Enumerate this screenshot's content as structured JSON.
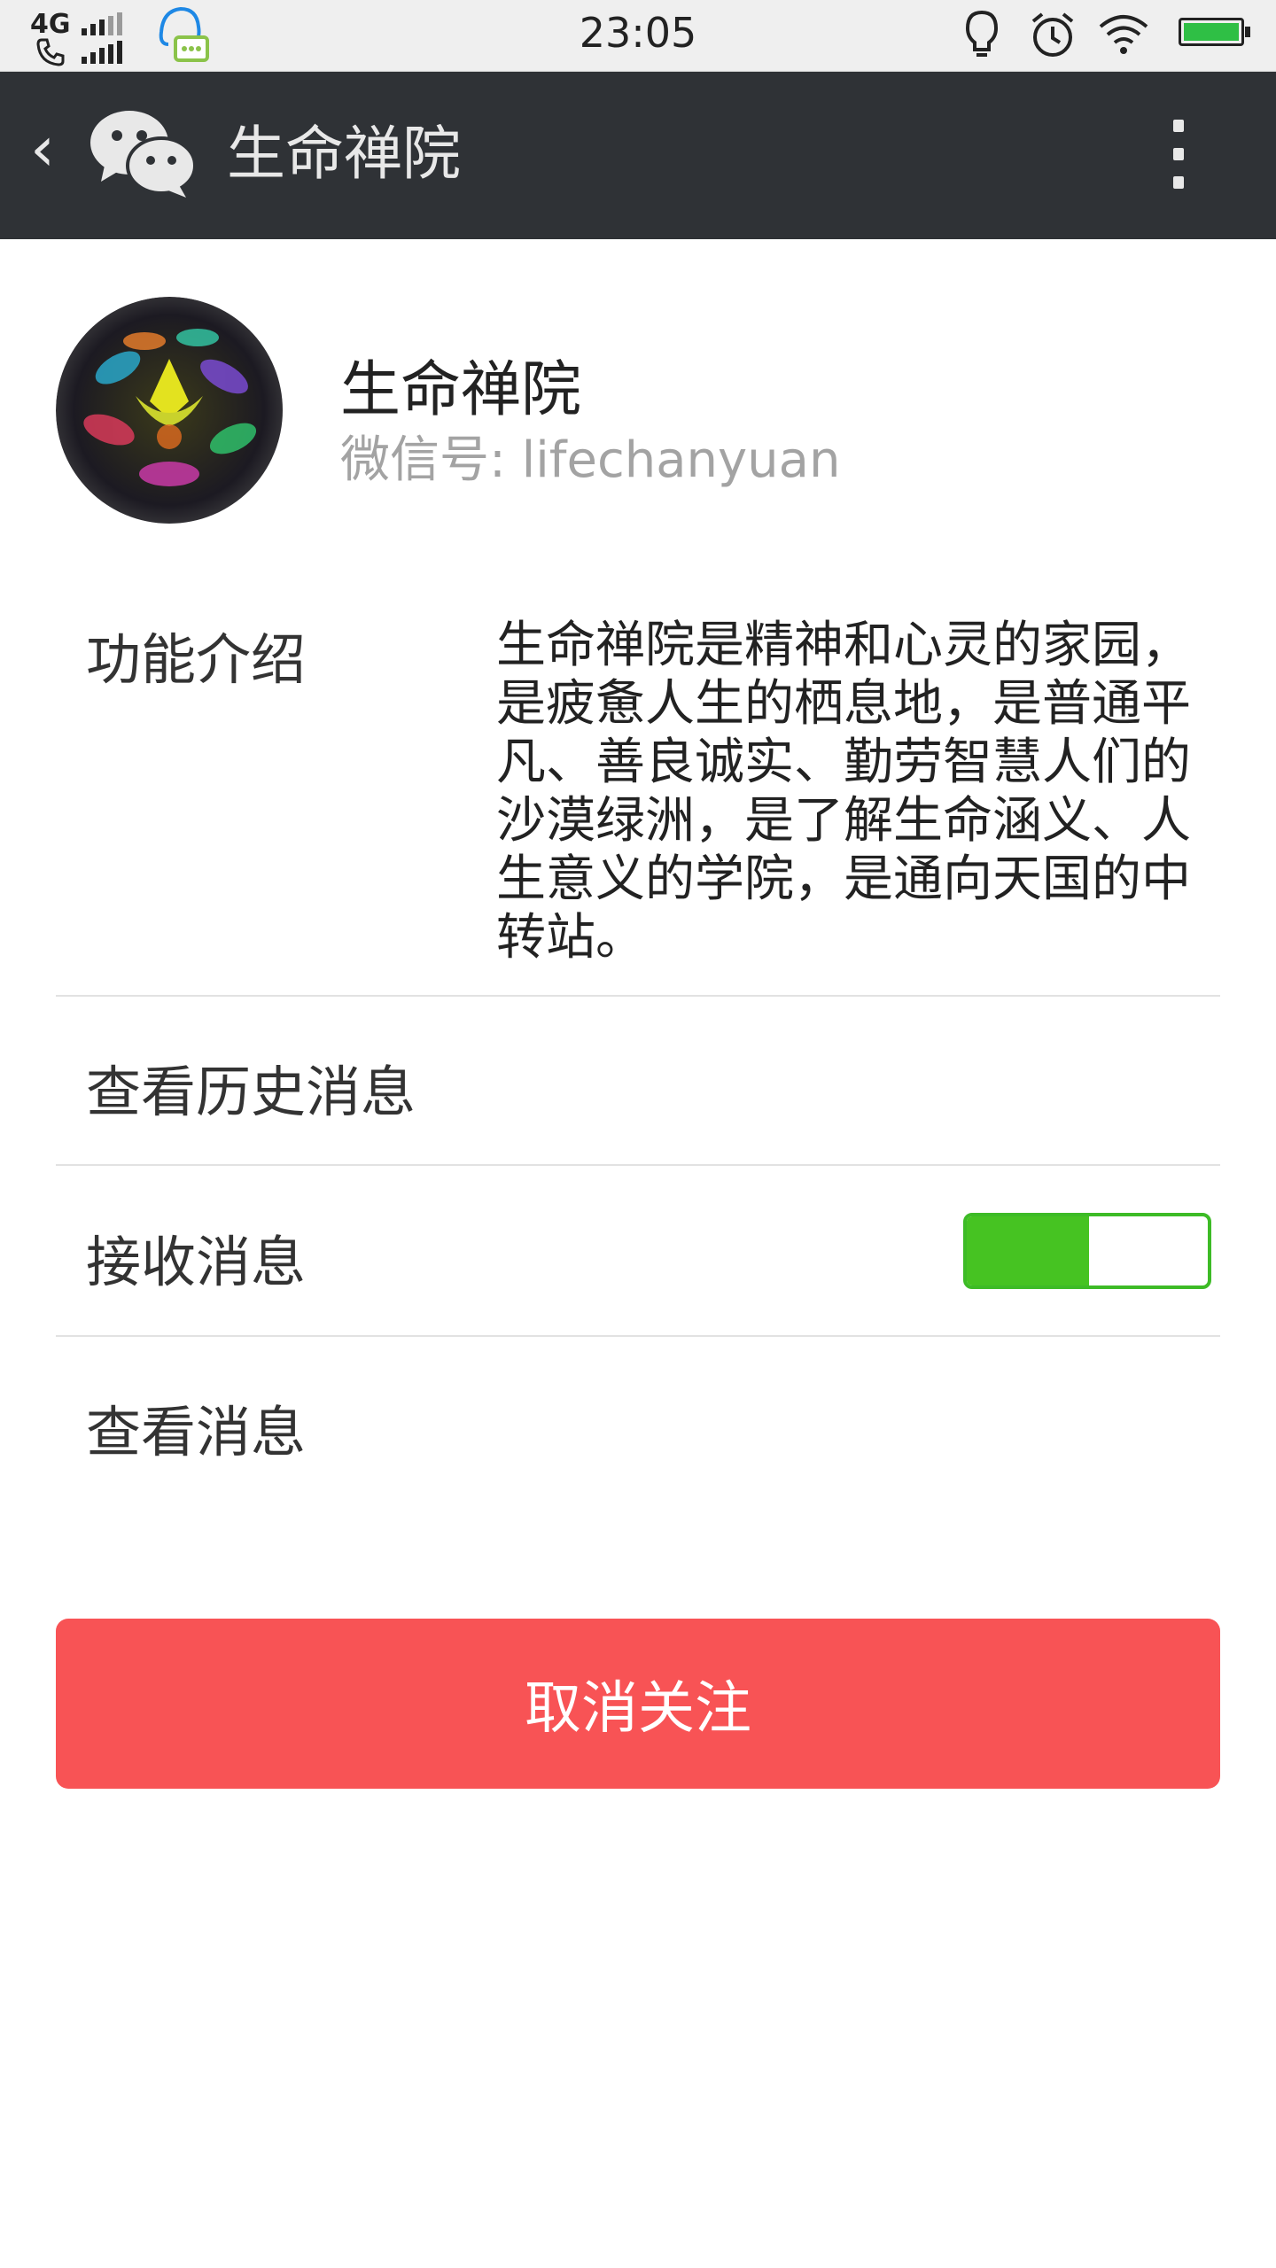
{
  "status_bar": {
    "network": "4G",
    "time": "23:05",
    "icons": [
      "phone-icon",
      "signal-icon",
      "qq-icon",
      "bulb-icon",
      "alarm-icon",
      "wifi-icon",
      "battery-icon"
    ]
  },
  "header": {
    "back_icon": "chevron-left-icon",
    "app_icon": "wechat-icon",
    "title": "生命禅院",
    "menu_icon": "more-vertical-icon"
  },
  "profile": {
    "name": "生命禅院",
    "wechat_id": "微信号: lifechanyuan"
  },
  "intro": {
    "label": "功能介绍",
    "text": "生命禅院是精神和心灵的家园，是疲惫人生的栖息地，是普通平凡、善良诚实、勤劳智慧人们的沙漠绿洲，是了解生命涵义、人生意义的学院，是通向天国的中转站。"
  },
  "rows": {
    "history": "查看历史消息",
    "receive": "接收消息",
    "receive_enabled": true,
    "view": "查看消息"
  },
  "actions": {
    "unfollow": "取消关注"
  },
  "colors": {
    "title_bar": "#2f3236",
    "toggle_on": "#46c322",
    "unfollow_button": "#f85355"
  }
}
